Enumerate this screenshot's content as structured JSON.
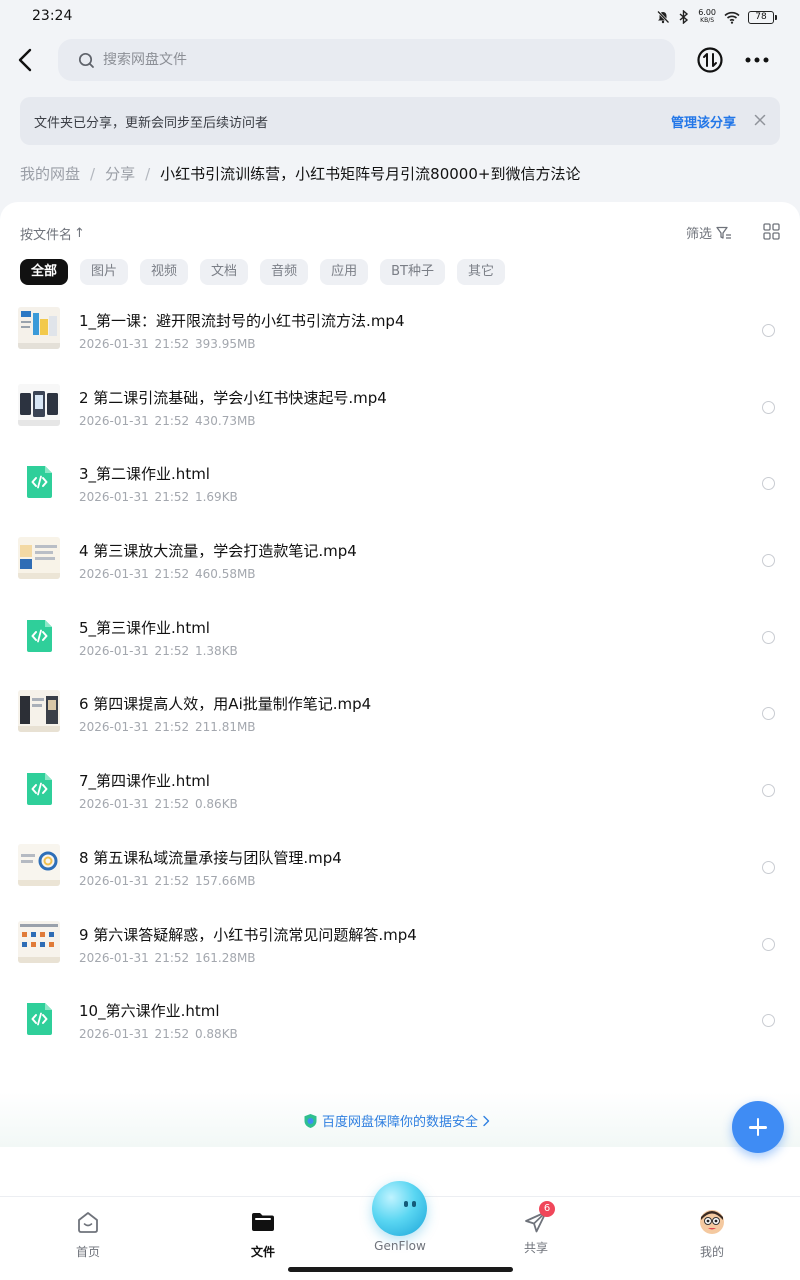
{
  "status_bar": {
    "time": "23:24",
    "net_speed": "6.00",
    "net_unit": "KB/S",
    "battery": "78",
    "icons": [
      "mute-icon",
      "bluetooth-icon",
      "wifi-icon",
      "battery-icon"
    ]
  },
  "top_bar": {
    "search_placeholder": "搜索网盘文件",
    "icons": [
      "back-icon",
      "search-icon",
      "transfer-icon",
      "more-icon"
    ]
  },
  "share_notice": {
    "text": "文件夹已分享，更新会同步至后续访问者",
    "action": "管理该分享"
  },
  "breadcrumb": {
    "items": [
      "我的网盘",
      "分享"
    ],
    "separator": "/",
    "current": "小红书引流训练营，小红书矩阵号月引流80000+到微信方法论"
  },
  "toolbar": {
    "sort_label": "按文件名",
    "sort_arrow": "↑",
    "filter_label": "筛选"
  },
  "filters": [
    "全部",
    "图片",
    "视频",
    "文档",
    "音频",
    "应用",
    "BT种子",
    "其它"
  ],
  "files": [
    {
      "name": "1_第一课：避开限流封号的小红书引流方法.mp4",
      "date": "2026-01-31  21:52",
      "size": "393.95MB",
      "type": "video"
    },
    {
      "name": "2 第二课引流基础，学会小红书快速起号.mp4",
      "date": "2026-01-31  21:52",
      "size": "430.73MB",
      "type": "video"
    },
    {
      "name": "3_第二课作业.html",
      "date": "2026-01-31  21:52",
      "size": "1.69KB",
      "type": "html"
    },
    {
      "name": "4 第三课放大流量，学会打造款笔记.mp4",
      "date": "2026-01-31  21:52",
      "size": "460.58MB",
      "type": "video"
    },
    {
      "name": "5_第三课作业.html",
      "date": "2026-01-31  21:52",
      "size": "1.38KB",
      "type": "html"
    },
    {
      "name": "6 第四课提高人效，用Ai批量制作笔记.mp4",
      "date": "2026-01-31  21:52",
      "size": "211.81MB",
      "type": "video"
    },
    {
      "name": "7_第四课作业.html",
      "date": "2026-01-31  21:52",
      "size": "0.86KB",
      "type": "html"
    },
    {
      "name": "8 第五课私域流量承接与团队管理.mp4",
      "date": "2026-01-31  21:52",
      "size": "157.66MB",
      "type": "video"
    },
    {
      "name": "9 第六课答疑解惑，小红书引流常见问题解答.mp4",
      "date": "2026-01-31  21:52",
      "size": "161.28MB",
      "type": "video"
    },
    {
      "name": "10_第六课作业.html",
      "date": "2026-01-31  21:52",
      "size": "0.88KB",
      "type": "html"
    }
  ],
  "safety_banner": "百度网盘保障你的数据安全",
  "bottom_nav": {
    "items": [
      {
        "label": "首页",
        "icon": "home-icon"
      },
      {
        "label": "文件",
        "icon": "folder-icon",
        "active": true
      },
      {
        "label": "GenFlow",
        "icon": "genflow-orb-icon"
      },
      {
        "label": "共享",
        "icon": "share-plane-icon",
        "badge": "6"
      },
      {
        "label": "我的",
        "icon": "avatar-icon"
      }
    ]
  },
  "colors": {
    "accent": "#2377e8",
    "fab": "#3f8cf4",
    "html_icon": "#2fcf9a",
    "badge": "#f0475a"
  }
}
